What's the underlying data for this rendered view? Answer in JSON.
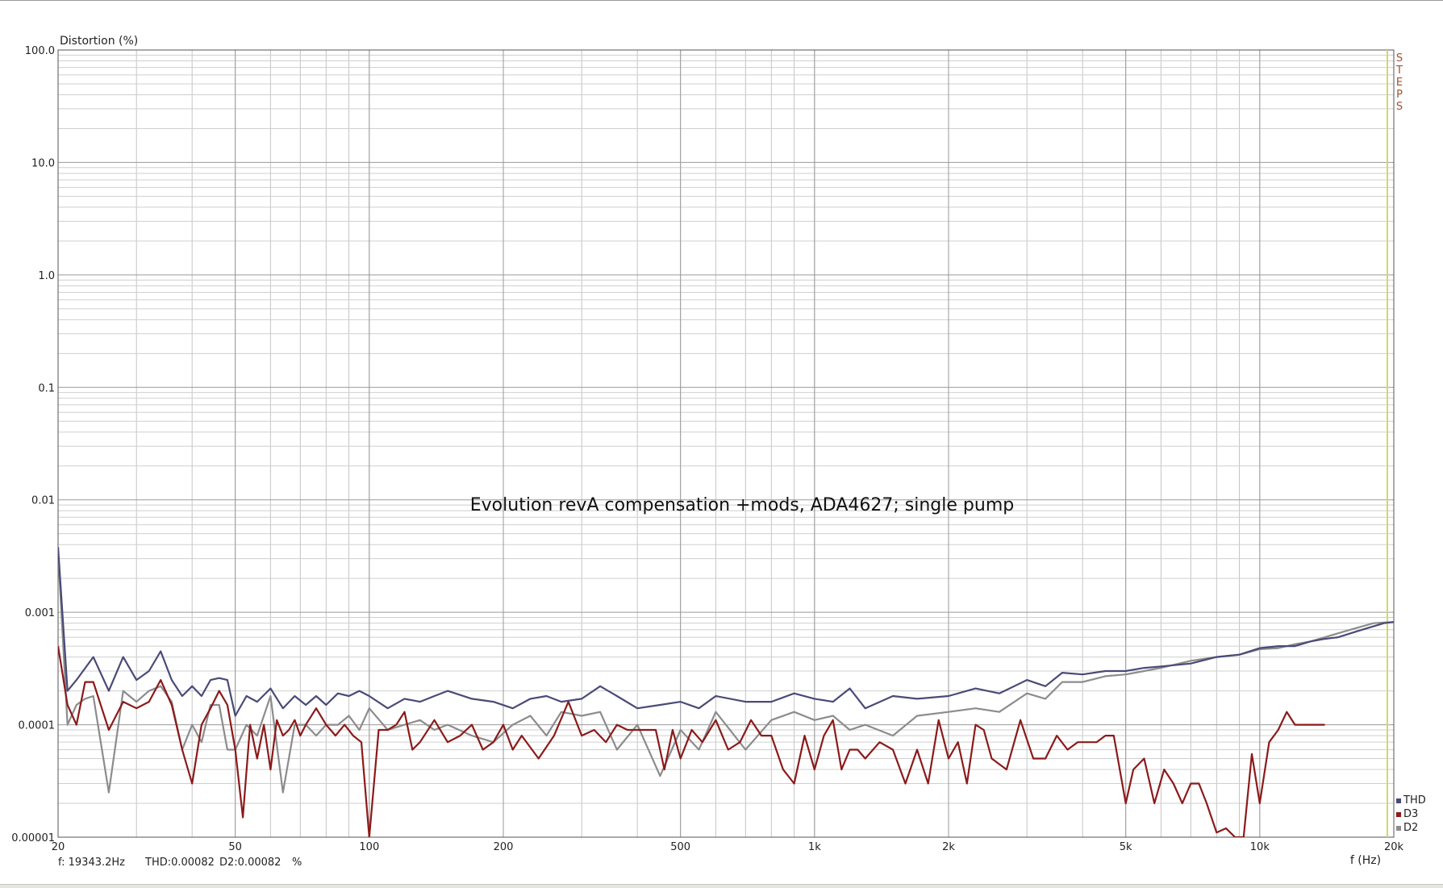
{
  "chart_data": {
    "type": "line",
    "title": "Evolution revA compensation +mods, ADA4627; single pump",
    "ylabel": "Distortion (%)",
    "xlabel": "f (Hz)",
    "xscale": "log",
    "yscale": "log",
    "xlim": [
      20,
      20000
    ],
    "ylim": [
      1e-05,
      100
    ],
    "grid": true,
    "legend_position": "bottom-right",
    "x_ticks": [
      {
        "value": 20,
        "label": "20"
      },
      {
        "value": 50,
        "label": "50"
      },
      {
        "value": 100,
        "label": "100"
      },
      {
        "value": 200,
        "label": "200"
      },
      {
        "value": 500,
        "label": "500"
      },
      {
        "value": 1000,
        "label": "1k"
      },
      {
        "value": 2000,
        "label": "2k"
      },
      {
        "value": 5000,
        "label": "5k"
      },
      {
        "value": 10000,
        "label": "10k"
      },
      {
        "value": 20000,
        "label": "20k"
      }
    ],
    "y_ticks": [
      {
        "value": 100,
        "label": "100.0"
      },
      {
        "value": 10,
        "label": "10.0"
      },
      {
        "value": 1,
        "label": "1.0"
      },
      {
        "value": 0.1,
        "label": "0.1"
      },
      {
        "value": 0.01,
        "label": "0.01"
      },
      {
        "value": 0.001,
        "label": "0.001"
      },
      {
        "value": 0.0001,
        "label": "0.0001"
      },
      {
        "value": 1e-05,
        "label": "0.00001"
      }
    ],
    "cursor_frequency": 19343.2,
    "side_label": "STEPS",
    "status": {
      "frequency": "f: 19343.2Hz",
      "thd": "THD:0.00082",
      "d2": "D2:0.00082",
      "unit": "%"
    },
    "series": [
      {
        "name": "THD",
        "color": "#4a4a78",
        "x": [
          20,
          21,
          22,
          24,
          26,
          28,
          30,
          32,
          34,
          36,
          38,
          40,
          42,
          44,
          46,
          48,
          50,
          53,
          56,
          60,
          64,
          68,
          72,
          76,
          80,
          85,
          90,
          95,
          100,
          110,
          120,
          130,
          140,
          150,
          170,
          190,
          210,
          230,
          250,
          270,
          300,
          330,
          360,
          400,
          450,
          500,
          550,
          600,
          700,
          800,
          900,
          1000,
          1100,
          1200,
          1300,
          1500,
          1700,
          2000,
          2300,
          2600,
          3000,
          3300,
          3600,
          4000,
          4500,
          5000,
          5500,
          6000,
          7000,
          8000,
          9000,
          10000,
          11000,
          12000,
          13000,
          14000,
          15000,
          16000,
          17000,
          18000,
          19000,
          20000
        ],
        "values": [
          0.0038,
          0.0002,
          0.00025,
          0.0004,
          0.0002,
          0.0004,
          0.00025,
          0.0003,
          0.00045,
          0.00025,
          0.00018,
          0.00022,
          0.00018,
          0.00025,
          0.00026,
          0.00025,
          0.00012,
          0.00018,
          0.00016,
          0.00021,
          0.00014,
          0.00018,
          0.00015,
          0.00018,
          0.00015,
          0.00019,
          0.00018,
          0.0002,
          0.00018,
          0.00014,
          0.00017,
          0.00016,
          0.00018,
          0.0002,
          0.00017,
          0.00016,
          0.00014,
          0.00017,
          0.00018,
          0.00016,
          0.00017,
          0.00022,
          0.00018,
          0.00014,
          0.00015,
          0.00016,
          0.00014,
          0.00018,
          0.00016,
          0.00016,
          0.00019,
          0.00017,
          0.00016,
          0.00021,
          0.00014,
          0.00018,
          0.00017,
          0.00018,
          0.00021,
          0.00019,
          0.00025,
          0.00022,
          0.00029,
          0.00028,
          0.0003,
          0.0003,
          0.00032,
          0.00033,
          0.00035,
          0.0004,
          0.00042,
          0.00048,
          0.0005,
          0.0005,
          0.00055,
          0.00058,
          0.0006,
          0.00065,
          0.0007,
          0.00075,
          0.0008,
          0.00082
        ]
      },
      {
        "name": "D3",
        "color": "#8b1a1a",
        "x": [
          20,
          21,
          22,
          23,
          24,
          26,
          28,
          30,
          32,
          34,
          36,
          38,
          40,
          42,
          44,
          46,
          48,
          50,
          52,
          54,
          56,
          58,
          60,
          62,
          64,
          66,
          68,
          70,
          72,
          76,
          80,
          84,
          88,
          92,
          96,
          100,
          105,
          110,
          115,
          120,
          125,
          130,
          140,
          150,
          160,
          170,
          180,
          190,
          200,
          210,
          220,
          240,
          260,
          280,
          300,
          320,
          340,
          360,
          380,
          400,
          420,
          440,
          460,
          480,
          500,
          530,
          560,
          600,
          640,
          680,
          720,
          760,
          800,
          850,
          900,
          950,
          1000,
          1050,
          1100,
          1150,
          1200,
          1250,
          1300,
          1400,
          1500,
          1600,
          1700,
          1800,
          1900,
          2000,
          2100,
          2200,
          2300,
          2400,
          2500,
          2700,
          2900,
          3100,
          3300,
          3500,
          3700,
          3900,
          4100,
          4300,
          4500,
          4700,
          5000,
          5200,
          5500,
          5800,
          6100,
          6400,
          6700,
          7000,
          7300,
          7600,
          8000,
          8400,
          8800,
          9200,
          9600,
          10000,
          10500,
          11000,
          11500,
          12000,
          12500,
          13000,
          13500,
          14000
        ],
        "values": [
          0.0005,
          0.00015,
          0.0001,
          0.00024,
          0.00024,
          9e-05,
          0.00016,
          0.00014,
          0.00016,
          0.00025,
          0.00015,
          6e-05,
          3e-05,
          0.0001,
          0.00014,
          0.0002,
          0.00015,
          6e-05,
          1.5e-05,
          0.0001,
          5e-05,
          0.0001,
          4e-05,
          0.00011,
          8e-05,
          9e-05,
          0.00011,
          8e-05,
          0.0001,
          0.00014,
          0.0001,
          8e-05,
          0.0001,
          8e-05,
          7e-05,
          1e-05,
          9e-05,
          9e-05,
          0.0001,
          0.00013,
          6e-05,
          7e-05,
          0.00011,
          7e-05,
          8e-05,
          0.0001,
          6e-05,
          7e-05,
          0.0001,
          6e-05,
          8e-05,
          5e-05,
          8e-05,
          0.00016,
          8e-05,
          9e-05,
          7e-05,
          0.0001,
          9e-05,
          9e-05,
          9e-05,
          9e-05,
          4e-05,
          9e-05,
          5e-05,
          9e-05,
          7e-05,
          0.00011,
          6e-05,
          7e-05,
          0.00011,
          8e-05,
          8e-05,
          4e-05,
          3e-05,
          8e-05,
          4e-05,
          8e-05,
          0.00011,
          4e-05,
          6e-05,
          6e-05,
          5e-05,
          7e-05,
          6e-05,
          3e-05,
          6e-05,
          3e-05,
          0.00011,
          5e-05,
          7e-05,
          3e-05,
          0.0001,
          9e-05,
          5e-05,
          4e-05,
          0.00011,
          5e-05,
          5e-05,
          8e-05,
          6e-05,
          7e-05,
          7e-05,
          7e-05,
          8e-05,
          8e-05,
          2e-05,
          4e-05,
          5e-05,
          2e-05,
          4e-05,
          3e-05,
          2e-05,
          3e-05,
          3e-05,
          2e-05,
          1.1e-05,
          1.2e-05,
          1e-05,
          1e-05,
          5.5e-05,
          2e-05,
          7e-05,
          9e-05,
          0.00013,
          0.0001,
          0.0001,
          0.0001,
          0.0001,
          0.0001
        ]
      },
      {
        "name": "D2",
        "color": "#8c8c8c",
        "x": [
          20,
          21,
          22,
          23,
          24,
          26,
          28,
          30,
          32,
          34,
          36,
          38,
          40,
          42,
          44,
          46,
          48,
          50,
          53,
          56,
          60,
          64,
          68,
          72,
          76,
          80,
          85,
          90,
          95,
          100,
          110,
          120,
          130,
          140,
          150,
          170,
          190,
          210,
          230,
          250,
          270,
          300,
          330,
          360,
          400,
          450,
          500,
          550,
          600,
          700,
          800,
          900,
          1000,
          1100,
          1200,
          1300,
          1500,
          1700,
          2000,
          2300,
          2600,
          3000,
          3300,
          3600,
          4000,
          4500,
          5000,
          5500,
          6000,
          7000,
          8000,
          9000,
          10000,
          11000,
          12000,
          13000,
          14000,
          15000,
          16000,
          17000,
          18000,
          19000,
          20000
        ],
        "values": [
          0.0035,
          0.0001,
          0.00015,
          0.00017,
          0.00018,
          2.5e-05,
          0.0002,
          0.00016,
          0.0002,
          0.00022,
          0.00016,
          6e-05,
          0.0001,
          7e-05,
          0.00015,
          0.00015,
          6e-05,
          6e-05,
          0.0001,
          8e-05,
          0.00018,
          2.5e-05,
          0.0001,
          0.0001,
          8e-05,
          0.0001,
          0.0001,
          0.00012,
          9e-05,
          0.00014,
          9e-05,
          0.0001,
          0.00011,
          9e-05,
          0.0001,
          8e-05,
          7e-05,
          0.0001,
          0.00012,
          8e-05,
          0.00013,
          0.00012,
          0.00013,
          6e-05,
          0.0001,
          3.5e-05,
          9e-05,
          6e-05,
          0.00013,
          6e-05,
          0.00011,
          0.00013,
          0.00011,
          0.00012,
          9e-05,
          0.0001,
          8e-05,
          0.00012,
          0.00013,
          0.00014,
          0.00013,
          0.00019,
          0.00017,
          0.00024,
          0.00024,
          0.00027,
          0.00028,
          0.0003,
          0.00032,
          0.00037,
          0.0004,
          0.00042,
          0.00047,
          0.00048,
          0.00052,
          0.00055,
          0.0006,
          0.00065,
          0.0007,
          0.00075,
          0.0008,
          0.00081,
          0.00082
        ]
      }
    ]
  }
}
